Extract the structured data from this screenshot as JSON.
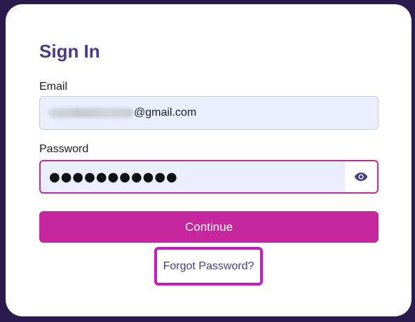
{
  "signin": {
    "title": "Sign In",
    "email": {
      "label": "Email",
      "value_suffix": "@gmail.com"
    },
    "password": {
      "label": "Password",
      "masked_value": "●●●●●●●●●●●"
    },
    "continue_label": "Continue",
    "forgot_label": "Forgot Password?"
  },
  "icons": {
    "password_toggle": "eye-icon"
  },
  "colors": {
    "background": "#2a1a4e",
    "title": "#4b3a86",
    "accent": "#c6279e",
    "highlight": "#cc18c4",
    "field_fill": "#e9effd"
  }
}
